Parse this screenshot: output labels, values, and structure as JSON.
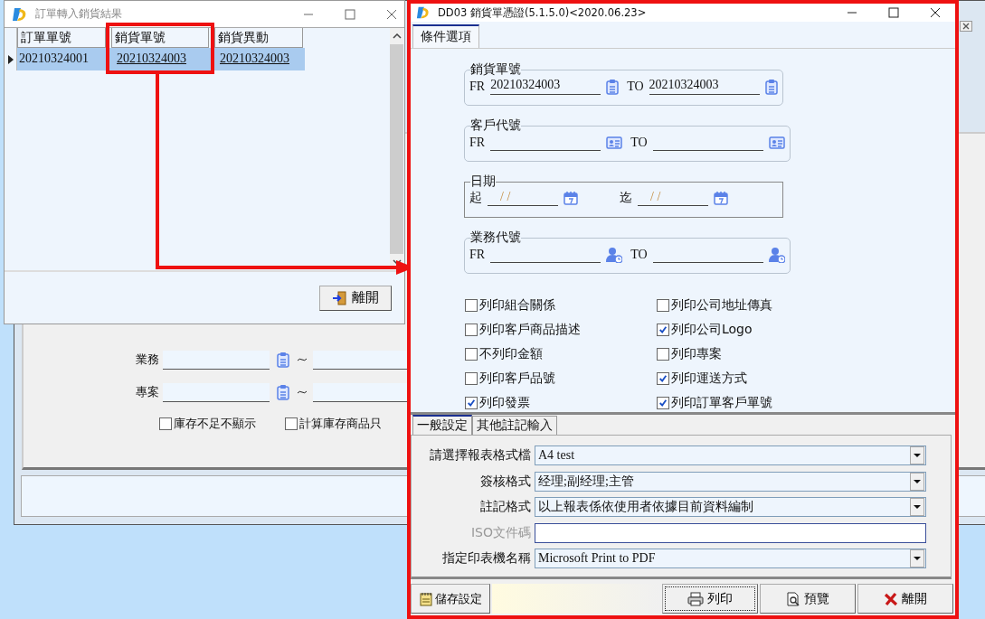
{
  "back_window": {
    "fields": [
      {
        "label": "業務"
      },
      {
        "label": "專案"
      }
    ],
    "checkboxes": [
      {
        "label": "庫存不足不顯示",
        "checked": false
      },
      {
        "label": "計算庫存商品只",
        "checked": false
      }
    ]
  },
  "result_window": {
    "title": "訂單轉入銷貨結果",
    "columns": [
      "訂單單號",
      "銷貨單號",
      "銷貨異動"
    ],
    "rows": [
      {
        "selected": true,
        "cells": [
          {
            "text": "20210324001",
            "link": false
          },
          {
            "text": "20210324003",
            "link": true
          },
          {
            "text": "20210324003",
            "link": true
          }
        ]
      }
    ],
    "exit_button": "離開"
  },
  "voucher_window": {
    "title": "DD03 銷貨單憑證(5.1.5.0)<2020.06.23>",
    "tabs": [
      {
        "label": "條件選項",
        "selected": true
      }
    ],
    "groups": [
      {
        "kind": "document",
        "title": "銷貨單號",
        "from_label": "FR",
        "from": "20210324003",
        "to_label": "TO",
        "to": "20210324003"
      },
      {
        "kind": "customer",
        "title": "客戶代號",
        "from_label": "FR",
        "to_label": "TO"
      },
      {
        "kind": "date",
        "title": "日期",
        "from_label": "起",
        "from": "/ /",
        "to_label": "迄",
        "to": "/ /"
      },
      {
        "kind": "staff",
        "title": "業務代號",
        "from_label": "FR",
        "to_label": "TO"
      }
    ],
    "options": [
      {
        "label": "列印組合關係",
        "checked": false
      },
      {
        "label": "列印公司地址傳真",
        "checked": false
      },
      {
        "label": "列印客戶商品描述",
        "checked": false
      },
      {
        "label": "列印公司Logo",
        "checked": true
      },
      {
        "label": "不列印金額",
        "checked": false
      },
      {
        "label": "列印專案",
        "checked": false
      },
      {
        "label": "列印客戶品號",
        "checked": false
      },
      {
        "label": "列印運送方式",
        "checked": true
      },
      {
        "label": "列印發票",
        "checked": true
      },
      {
        "label": "列印訂單客戶單號",
        "checked": true
      }
    ],
    "settings_tabs": [
      {
        "label": "一般設定",
        "selected": true
      },
      {
        "label": "其他註記輸入",
        "selected": false
      }
    ],
    "settings": [
      {
        "kind": "dropdown",
        "label": "請選擇報表格式檔",
        "value": "A4 test",
        "disabled": false
      },
      {
        "kind": "dropdown",
        "label": "簽核格式",
        "value": "经理;副经理;主管",
        "disabled": false
      },
      {
        "kind": "dropdown",
        "label": "註記格式",
        "value": "以上報表係依使用者依據目前資料編制",
        "disabled": false
      },
      {
        "kind": "text",
        "label": "ISO文件碼",
        "disabled": true
      },
      {
        "kind": "dropdown",
        "label": "指定印表機名稱",
        "value": "Microsoft Print to PDF",
        "disabled": false
      }
    ],
    "buttons": [
      {
        "kind": "save",
        "label": "儲存設定",
        "focused": false
      },
      {
        "kind": "print",
        "label": "列印",
        "focused": true
      },
      {
        "kind": "preview",
        "label": "預覽",
        "focused": false
      },
      {
        "kind": "exit",
        "label": "離開",
        "focused": false
      }
    ]
  }
}
